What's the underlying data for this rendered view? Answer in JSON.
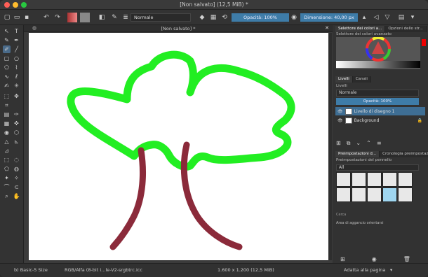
{
  "window": {
    "title": "[Non salvato] (12,5 MiB) *"
  },
  "toolbar": {
    "blend_mode": "Normale",
    "opacity": "Opacità: 100%",
    "dimension": "Dimensione: 40,00 px"
  },
  "document": {
    "tab_title": "[Non salvato] *"
  },
  "dock": {
    "color_tabs": [
      "Selettore dei colori a...",
      "Opzioni dello str..."
    ],
    "color_panel_title": "Selettore dei colori avanzato",
    "layer_tabs": [
      "Livelli",
      "Canali"
    ],
    "layers_title": "Livelli",
    "layer_blend": "Normale",
    "layer_opacity": "Opacità: 100%",
    "layers": [
      {
        "name": "Livello di disegno 1",
        "selected": true
      },
      {
        "name": "Background",
        "selected": false
      }
    ],
    "preset_tabs": [
      "Preimpostazioni d...",
      "Cronologia preimpostazioni de..."
    ],
    "preset_title": "Preimpostazioni del pennello",
    "preset_filter": "All",
    "search_placeholder": "Cerca",
    "history_title": "Area di aggancio orientarsi",
    "fit_label": "Adatta alla pagina"
  },
  "status": {
    "brush": "b) Basic-5 Size",
    "colorspace": "RGB/Alfa (8-bit i...le-V2-srgbtrc.icc",
    "size": "1.600 x 1.200 (12,5 MiB)"
  },
  "colors": {
    "accent": "#3e7ca8",
    "green_stroke": "#22ee22",
    "brown_stroke": "#8b2a3a"
  }
}
